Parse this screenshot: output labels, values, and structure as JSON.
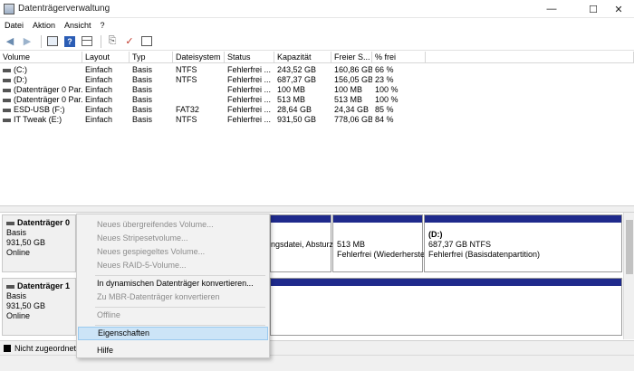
{
  "window": {
    "title": "Datenträgerverwaltung",
    "minimize": "—",
    "maximize": "☐",
    "close": "✕"
  },
  "menubar": [
    "Datei",
    "Aktion",
    "Ansicht",
    "?"
  ],
  "toolbar_icons": [
    "back-arrow",
    "forward-arrow",
    "disk-list",
    "help",
    "grid-view",
    "connect",
    "checklist",
    "properties"
  ],
  "table": {
    "headers": [
      "Volume",
      "Layout",
      "Typ",
      "Dateisystem",
      "Status",
      "Kapazität",
      "Freier S...",
      "% frei"
    ],
    "rows": [
      [
        "(C:)",
        "Einfach",
        "Basis",
        "NTFS",
        "Fehlerfrei ...",
        "243,52 GB",
        "160,86 GB",
        "66 %"
      ],
      [
        "(D:)",
        "Einfach",
        "Basis",
        "NTFS",
        "Fehlerfrei ...",
        "687,37 GB",
        "156,05 GB",
        "23 %"
      ],
      [
        "(Datenträger 0 Par...",
        "Einfach",
        "Basis",
        "",
        "Fehlerfrei ...",
        "100 MB",
        "100 MB",
        "100 %"
      ],
      [
        "(Datenträger 0 Par...",
        "Einfach",
        "Basis",
        "",
        "Fehlerfrei ...",
        "513 MB",
        "513 MB",
        "100 %"
      ],
      [
        "ESD-USB (F:)",
        "Einfach",
        "Basis",
        "FAT32",
        "Fehlerfrei ...",
        "28,64 GB",
        "24,34 GB",
        "85 %"
      ],
      [
        "IT Tweak (E:)",
        "Einfach",
        "Basis",
        "NTFS",
        "Fehlerfrei ...",
        "931,50 GB",
        "778,06 GB",
        "84 %"
      ]
    ]
  },
  "disks": [
    {
      "name": "Datenträger 0",
      "type": "Basis",
      "size": "931,50 GB",
      "state": "Online"
    },
    {
      "name": "Datenträger 1",
      "type": "Basis",
      "size": "931,50 GB",
      "state": "Online"
    }
  ],
  "partitions_disk0": [
    {
      "line1": "",
      "line2": "ngsdatei, Absturz"
    },
    {
      "line1": "513 MB",
      "line2": "Fehlerfrei (Wiederherstel"
    },
    {
      "line1": "(D:)",
      "line2": "687,37 GB NTFS",
      "line3": "Fehlerfrei (Basisdatenpartition)"
    }
  ],
  "legend": {
    "unallocated": "Nicht zugeordnet"
  },
  "context_menu": [
    {
      "label": "Neues übergreifendes Volume...",
      "enabled": false
    },
    {
      "label": "Neues Stripesetvolume...",
      "enabled": false
    },
    {
      "label": "Neues gespiegeltes Volume...",
      "enabled": false
    },
    {
      "label": "Neues RAID-5-Volume...",
      "enabled": false
    },
    {
      "label": "In dynamischen Datenträger konvertieren...",
      "enabled": true
    },
    {
      "label": "Zu MBR-Datenträger konvertieren",
      "enabled": false
    },
    {
      "label": "Offline",
      "enabled": false
    },
    {
      "label": "Eigenschaften",
      "enabled": true,
      "highlighted": true
    },
    {
      "label": "Hilfe",
      "enabled": true
    }
  ],
  "colors": {
    "partition_bar": "#1f2a8c",
    "menu_highlight": "#cce4f7"
  }
}
